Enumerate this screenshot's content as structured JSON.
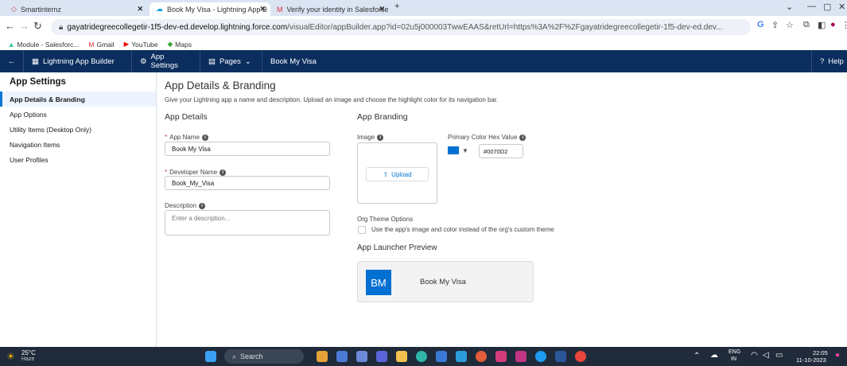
{
  "browser": {
    "tabs": [
      {
        "title": "Smartinternz"
      },
      {
        "title": "Book My Visa - Lightning App B"
      },
      {
        "title": "Verify your identity in Salesforce"
      }
    ],
    "url_domain": "gayatridegreecollegetir-1f5-dev-ed.develop.lightning.force.com",
    "url_rest": "/visualEditor/appBuilder.app?id=02u5j000003TwwEAAS&retUrl=https%3A%2F%2Fgayatridegreecollegetir-1f5-dev-ed.dev...",
    "bookmarks": [
      "Module - Salesforc...",
      "Gmail",
      "YouTube",
      "Maps"
    ]
  },
  "appbar": {
    "builder": "Lightning App Builder",
    "settings": "App Settings",
    "pages": "Pages",
    "app_name": "Book My Visa",
    "help": "Help"
  },
  "sidebar": {
    "title": "App Settings",
    "items": [
      {
        "label": "App Details & Branding"
      },
      {
        "label": "App Options"
      },
      {
        "label": "Utility Items (Desktop Only)"
      },
      {
        "label": "Navigation Items"
      },
      {
        "label": "User Profiles"
      }
    ]
  },
  "main": {
    "title": "App Details & Branding",
    "subtitle": "Give your Lightning app a name and description. Upload an image and choose the highlight color for its navigation bar.",
    "details_heading": "App Details",
    "app_name_label": "App Name",
    "app_name_value": "Book My Visa",
    "dev_name_label": "Developer Name",
    "dev_name_value": "Book_My_Visa",
    "desc_label": "Description",
    "desc_placeholder": "Enter a description...",
    "branding_heading": "App Branding",
    "image_label": "Image",
    "upload_label": "Upload",
    "color_label": "Primary Color Hex Value",
    "color_value": "#0070D2",
    "org_theme_label": "Org Theme Options",
    "org_theme_checkbox": "Use the app's image and color instead of the org's custom theme",
    "preview_heading": "App Launcher Preview",
    "preview_initials": "BM",
    "preview_name": "Book My Visa"
  },
  "taskbar": {
    "temp": "25°C",
    "weather": "Haze",
    "search": "Search",
    "lang": "ENG",
    "region": "IN",
    "time": "22:05",
    "date": "11-10-2023"
  },
  "colors": {
    "accent": "#0176d3",
    "brand": "#0070d2",
    "appbar": "#0b2e5e"
  }
}
